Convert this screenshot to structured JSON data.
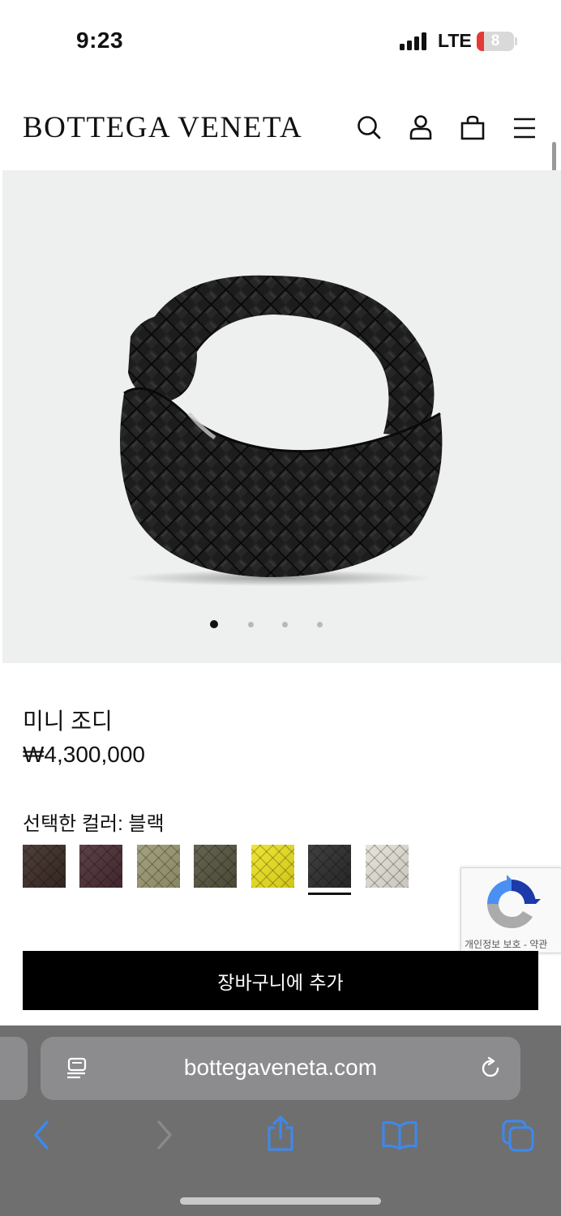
{
  "status_bar": {
    "time": "9:23",
    "network": "LTE",
    "battery": "8",
    "icons": [
      "signal-bars-icon",
      "battery-icon"
    ]
  },
  "header": {
    "brand": "BOTTEGA VENETA",
    "icons": [
      "search-icon",
      "account-icon",
      "shopping-bag-icon",
      "menu-icon"
    ]
  },
  "gallery": {
    "slide_count": 4,
    "active_slide": 1
  },
  "product": {
    "name": "미니 조디",
    "price": "₩4,300,000",
    "selected_color_label": "선택한 컬러: 블랙",
    "colors": [
      {
        "hex": "#3b2a25"
      },
      {
        "hex": "#4a2c33"
      },
      {
        "hex": "#9a9870"
      },
      {
        "hex": "#55533e"
      },
      {
        "hex": "#ece21e"
      },
      {
        "hex": "#2b2b2b",
        "selected": true
      },
      {
        "hex": "#e5e1d8"
      }
    ],
    "add_to_cart_label": "장바구니에 추가"
  },
  "recaptcha": {
    "links": "개인정보 보호 - 약관"
  },
  "browser": {
    "url": "bottegaveneta.com",
    "icons": [
      "reader-icon",
      "reload-icon",
      "back-icon",
      "forward-icon",
      "share-icon",
      "bookmarks-icon",
      "tabs-icon"
    ]
  },
  "colors": {
    "accent_blue": "#3b8af0",
    "button_black": "#000000",
    "image_bg": "#eef0ef"
  }
}
